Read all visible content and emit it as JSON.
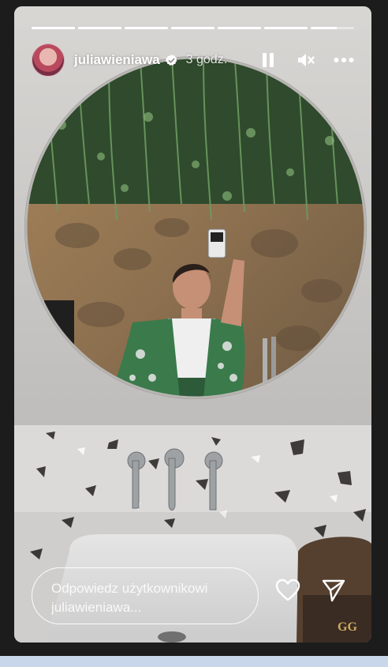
{
  "story": {
    "progress_segments": 7,
    "progress_fill": [
      1,
      1,
      1,
      1,
      1,
      1,
      0.6
    ],
    "user": {
      "username": "juliawieniawa",
      "verified": true,
      "time_ago": "3 godz."
    },
    "controls": {
      "pause_icon": "pause-icon",
      "mute_icon": "speaker-muted-icon",
      "more_icon": "more-horizontal-icon"
    },
    "reply": {
      "placeholder": "Odpowiedz użytkownikowi juliawieniawa..."
    },
    "actions": {
      "like_icon": "heart-outline-icon",
      "share_icon": "paper-plane-icon"
    }
  },
  "colors": {
    "text": "#ffffff",
    "verified": "#ffffff",
    "background": "#1c1c1c"
  }
}
